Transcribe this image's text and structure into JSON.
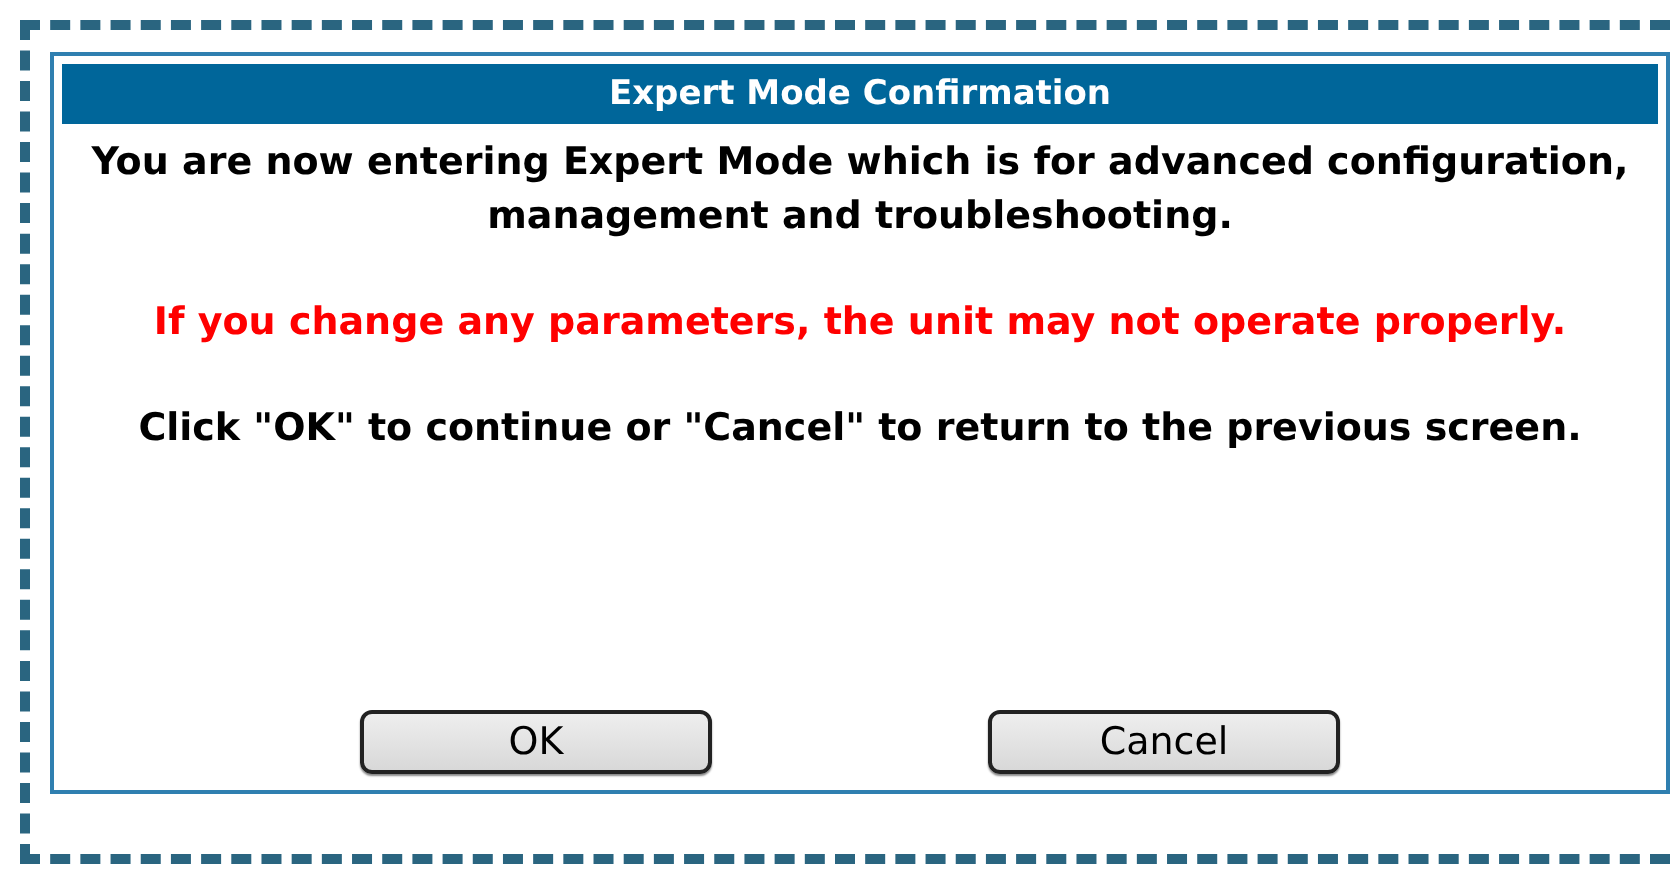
{
  "dialog": {
    "title": "Expert Mode Confirmation",
    "paragraphs": [
      {
        "kind": "info",
        "text": "You are now entering Expert Mode which is for advanced configuration, management and troubleshooting."
      },
      {
        "kind": "warning",
        "text": "If you change any parameters, the unit may not operate properly."
      },
      {
        "kind": "info",
        "text": "Click \"OK\" to continue or \"Cancel\" to return to the previous screen."
      }
    ],
    "buttons": [
      "OK",
      "Cancel"
    ]
  }
}
